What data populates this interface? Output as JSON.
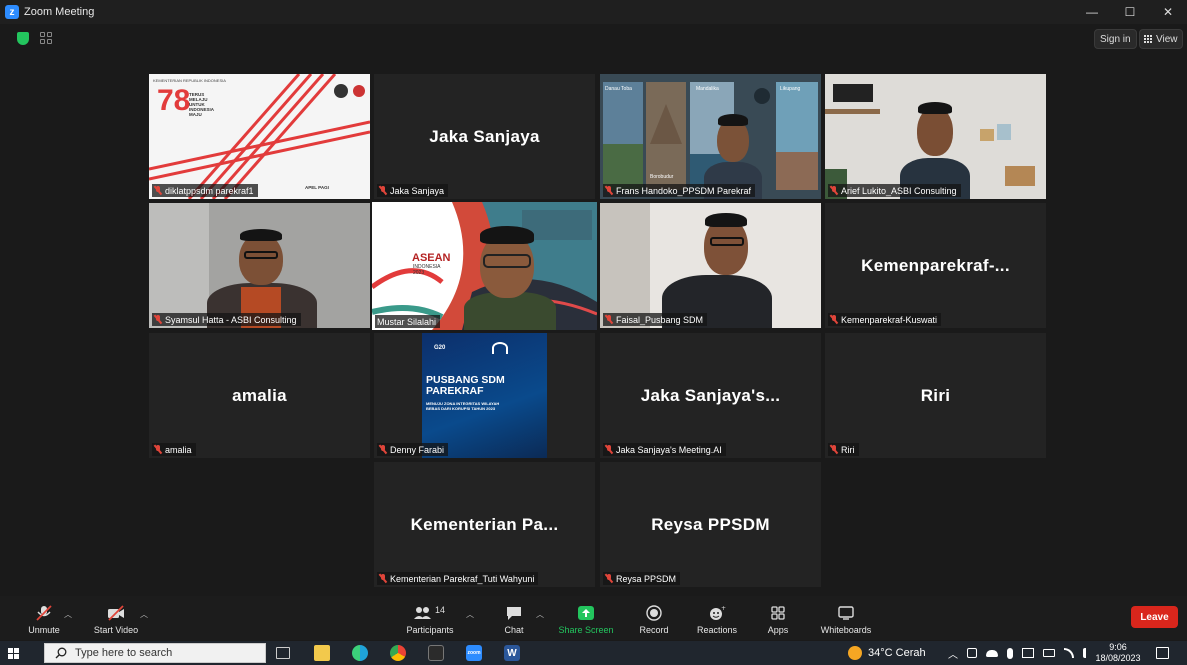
{
  "window": {
    "title": "Zoom Meeting",
    "minimize": "—",
    "maximize": "☐",
    "close": "✕"
  },
  "topbar": {
    "sign_in": "Sign in",
    "view": "View"
  },
  "tiles": [
    {
      "label": "diklatppsdm parekraf1",
      "slide_lines": [
        "KEMENTERIAN REPUBLIK INDONESIA",
        "TERUS",
        "MELAJU",
        "UNTUK",
        "INDONESIA",
        "MAJU"
      ],
      "slide_num": "78",
      "footer": "APEL PAGI"
    },
    {
      "label": "Jaka Sanjaya",
      "name": "Jaka Sanjaya"
    },
    {
      "label": "Frans Handoko_PPSDM Parekraf",
      "bg_words": [
        "Danau Toba",
        "Mandalika",
        "Labuan Bajo",
        "Likupang",
        "Borobudur"
      ]
    },
    {
      "label": "Arief Lukito_ASBI Consulting"
    },
    {
      "label": "Syamsul Hatta - ASBI Consulting"
    },
    {
      "label": "Mustar Silalahi",
      "bg_logo": "ASEAN",
      "bg_sub": "INDONESIA",
      "bg_year": "2023"
    },
    {
      "label": "Faisal_Pusbang SDM"
    },
    {
      "label": "Kemenparekraf-Kuswati",
      "name": "Kemenparekraf-..."
    },
    {
      "label": "amalia",
      "name": "amalia"
    },
    {
      "label": "Denny Farabi",
      "poster_title": "PUSBANG SDM PAREKRAF",
      "poster_sub": "MENUJU ZONA INTEGRITAS WILAYAH BEBAS DARI KORUPSI TAHUN 2023",
      "poster_logo": "G20"
    },
    {
      "label": "Jaka Sanjaya's Meeting.AI",
      "name": "Jaka Sanjaya's..."
    },
    {
      "label": "Riri",
      "name": "Riri"
    },
    {
      "label": "Kementerian Parekraf_Tuti Wahyuni",
      "name": "Kementerian Pa..."
    },
    {
      "label": "Reysa PPSDM",
      "name": "Reysa PPSDM"
    }
  ],
  "toolbar": {
    "unmute": "Unmute",
    "start_video": "Start Video",
    "participants": "Participants",
    "participants_count": "14",
    "chat": "Chat",
    "share_screen": "Share Screen",
    "record": "Record",
    "reactions": "Reactions",
    "apps": "Apps",
    "whiteboards": "Whiteboards",
    "leave": "Leave"
  },
  "taskbar": {
    "search_placeholder": "Type here to search",
    "weather": "34°C  Cerah",
    "time": "9:06",
    "date": "18/08/2023",
    "zoom_icon": "zoom",
    "word_icon": "W"
  },
  "colors": {
    "accent_blue": "#2d8cff",
    "leave_red": "#d9261c",
    "share_green": "#23c55e",
    "active_border": "#e3e76a"
  }
}
